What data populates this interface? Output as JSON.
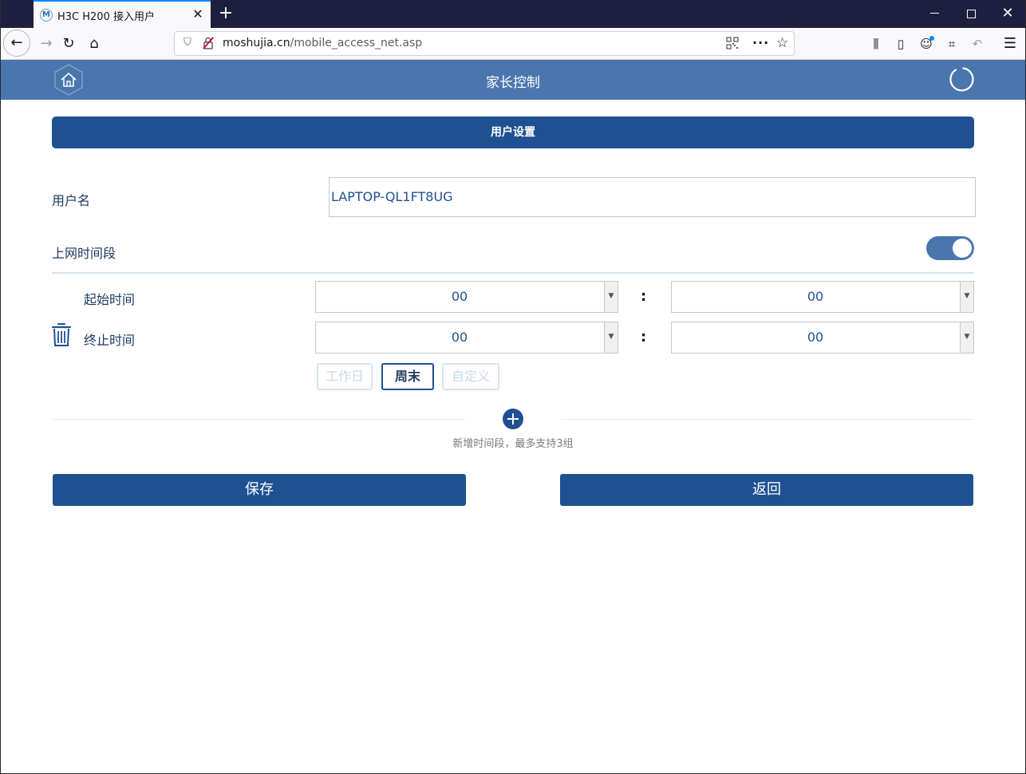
{
  "browser": {
    "tab_title": "H3C H200 接入用户",
    "tab_favicon": "M",
    "url_host": "moshujia.cn",
    "url_path": "/mobile_access_net.asp"
  },
  "header": {
    "title": "家长控制"
  },
  "section": {
    "title": "用户设置"
  },
  "form": {
    "username_label": "用户名",
    "username_value": "LAPTOP-QL1FT8UG",
    "period_label": "上网时间段",
    "period_enabled": true,
    "start_label": "起始时间",
    "end_label": "终止时间",
    "start_hour": "00",
    "start_minute": "00",
    "end_hour": "00",
    "end_minute": "00",
    "colon": ":",
    "day_options": {
      "workday": "工作日",
      "weekend": "周末",
      "custom": "自定义"
    },
    "selected_day_option": "周末",
    "add_hint": "新增时间段，最多支持3组"
  },
  "actions": {
    "save_label": "保存",
    "back_label": "返回"
  },
  "colors": {
    "header_bg": "#4a76ad",
    "primary": "#1f5192",
    "text_blue": "#1f3a5f"
  }
}
